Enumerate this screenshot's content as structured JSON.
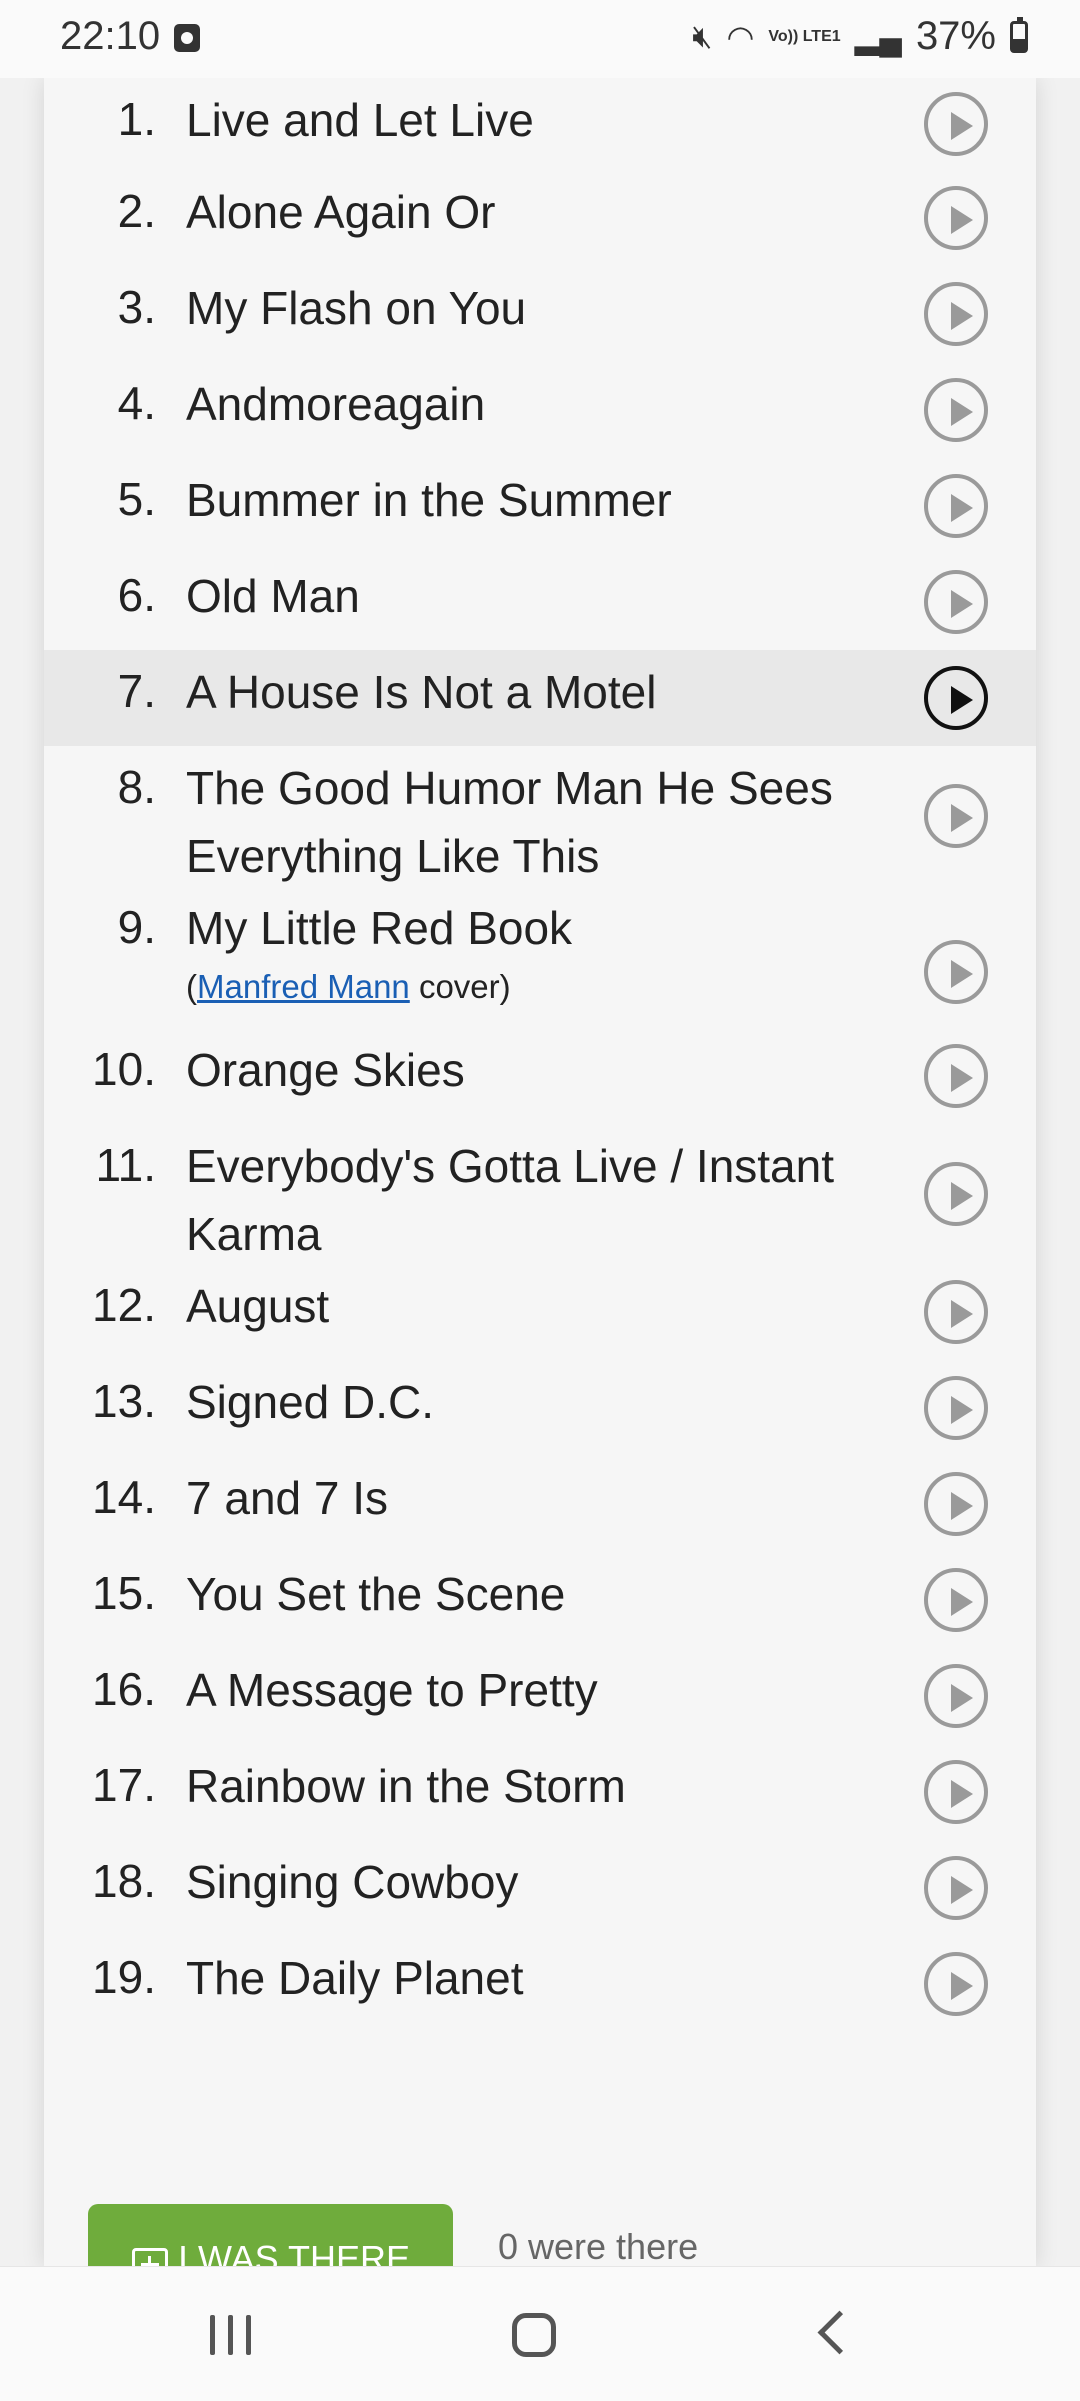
{
  "status_bar": {
    "time": "22:10",
    "network_label": "Vo)) LTE1",
    "battery": "37%"
  },
  "tracks": [
    {
      "num": "1.",
      "title": "Live and Let Live"
    },
    {
      "num": "2.",
      "title": "Alone Again Or"
    },
    {
      "num": "3.",
      "title": "My Flash on You"
    },
    {
      "num": "4.",
      "title": "Andmoreagain"
    },
    {
      "num": "5.",
      "title": "Bummer in the Summer"
    },
    {
      "num": "6.",
      "title": "Old Man"
    },
    {
      "num": "7.",
      "title": "A House Is Not a Motel",
      "active": true
    },
    {
      "num": "8.",
      "title": "The Good Humor Man He Sees Everything Like This"
    },
    {
      "num": "9.",
      "title": "My Little Red Book",
      "note": {
        "prefix": "(",
        "link": "Manfred Mann",
        "suffix": " cover)"
      }
    },
    {
      "num": "10.",
      "title": "Orange Skies"
    },
    {
      "num": "11.",
      "title": "Everybody's Gotta Live / Instant Karma"
    },
    {
      "num": "12.",
      "title": "August"
    },
    {
      "num": "13.",
      "title": "Signed D.C."
    },
    {
      "num": "14.",
      "title": "7 and 7 Is"
    },
    {
      "num": "15.",
      "title": "You Set the Scene"
    },
    {
      "num": "16.",
      "title": "A Message to Pretty"
    },
    {
      "num": "17.",
      "title": "Rainbow in the Storm"
    },
    {
      "num": "18.",
      "title": "Singing Cowboy"
    },
    {
      "num": "19.",
      "title": "The Daily Planet"
    }
  ],
  "attendance": {
    "button_label": "I WAS THERE",
    "count_text": "0 were there"
  },
  "icons": {
    "play": "play-circle-icon",
    "plus": "plus-square-icon"
  },
  "colors": {
    "button_green": "#6fac3c",
    "link_blue": "#1a5fb4"
  }
}
